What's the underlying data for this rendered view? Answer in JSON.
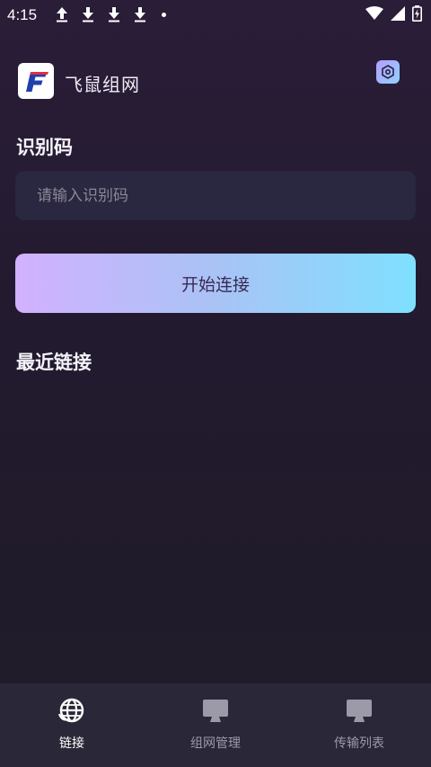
{
  "status_bar": {
    "time": "4:15"
  },
  "header": {
    "app_title": "飞鼠组网"
  },
  "connect": {
    "section_label": "识别码",
    "input_placeholder": "请输入识别码",
    "input_value": "",
    "button_label": "开始连接"
  },
  "recent": {
    "section_label": "最近链接"
  },
  "bottom_nav": {
    "items": [
      {
        "label": "链接",
        "icon": "globe-icon",
        "active": true
      },
      {
        "label": "组网管理",
        "icon": "monitor-icon",
        "active": false
      },
      {
        "label": "传输列表",
        "icon": "monitor-icon",
        "active": false
      }
    ]
  },
  "colors": {
    "accent_gradient_start": "#d2b1ff",
    "accent_gradient_end": "#7fe0ff",
    "nav_inactive": "#9c99a8",
    "logo_blue": "#1f3fae",
    "logo_red": "#e0303a"
  }
}
